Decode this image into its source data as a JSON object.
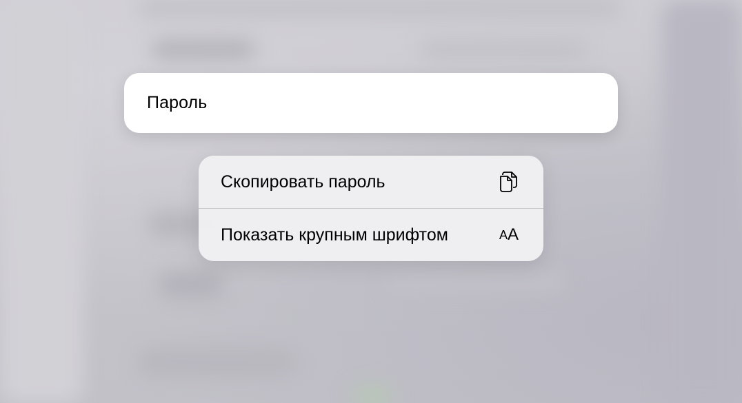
{
  "field": {
    "label": "Пароль"
  },
  "menu": {
    "items": [
      {
        "label": "Скопировать пароль",
        "icon": "copy-documents-icon"
      },
      {
        "label": "Показать крупным шрифтом",
        "icon": "text-size-icon",
        "glyph_small": "A",
        "glyph_large": "A"
      }
    ]
  },
  "colors": {
    "card": "#ffffff",
    "menu": "#f0f0f2",
    "separator": "#c6c6c9",
    "text": "#000000"
  }
}
